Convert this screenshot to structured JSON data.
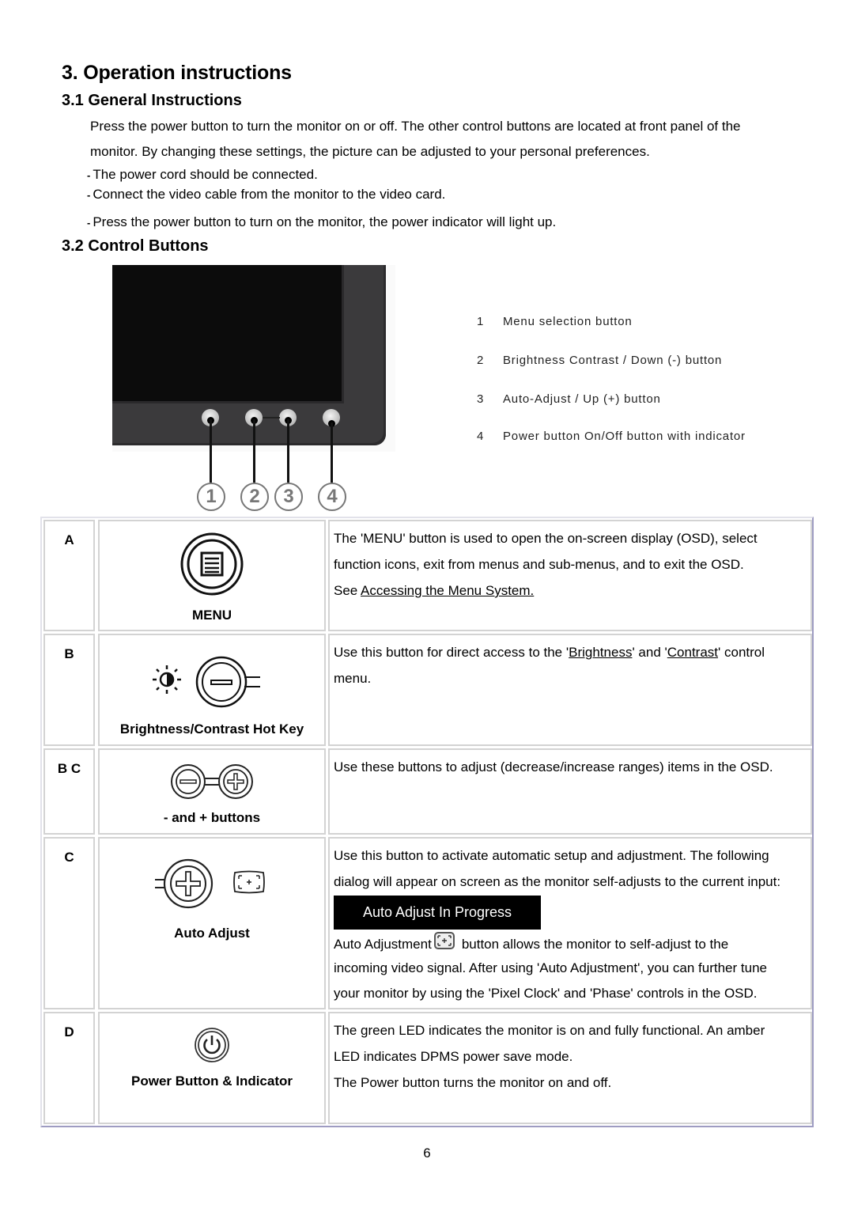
{
  "doc": {
    "title": "3. Operation instructions",
    "sections": {
      "general": {
        "heading": "3.1 General Instructions",
        "intro_line1": "Press the power button to turn the monitor on or off. The other control buttons are located at front panel of the",
        "intro_line2": "monitor. By changing these settings, the picture can be adjusted to your personal preferences.",
        "bullets": [
          "The power cord should be connected.",
          "Connect the video cable from the monitor to the video card.",
          "Press the power button to turn on the monitor, the power indicator will light up."
        ],
        "bullet_marker": "-"
      },
      "control": {
        "heading": "3.2 Control Buttons",
        "figure": {
          "callouts": [
            "1",
            "2",
            "3",
            "4"
          ],
          "legend": [
            {
              "num": "1",
              "label": "Menu selection button"
            },
            {
              "num": "2",
              "label": "Brightness Contrast / Down (-) button"
            },
            {
              "num": "3",
              "label": "Auto-Adjust / Up (+) button"
            },
            {
              "num": "4",
              "label": "Power button On/Off button with indicator"
            }
          ]
        }
      }
    },
    "table": {
      "rows": [
        {
          "letter": "A",
          "icon": "menu-button-icon",
          "caption": "MENU",
          "desc_line1": "The 'MENU' button is used to open the on-screen display (OSD), select",
          "desc_line2": "function icons, exit from menus and sub-menus, and to exit the OSD.",
          "desc_see": "See ",
          "desc_link": "Accessing the Menu System."
        },
        {
          "letter": "B",
          "icon": "brightness-contrast-hotkey-icon",
          "caption": "Brightness/Contrast Hot Key",
          "desc_pre": "Use this button for direct access to the '",
          "desc_link1": "Brightness",
          "desc_mid": "' and '",
          "desc_link2": "Contrast",
          "desc_post": "' control",
          "desc_line2": "menu."
        },
        {
          "letter": "B C",
          "icon": "minus-plus-buttons-icon",
          "caption": "- and + buttons",
          "desc": "Use these buttons to adjust (decrease/increase ranges) items in the OSD."
        },
        {
          "letter": "C",
          "icon": "auto-adjust-icon",
          "caption": "Auto Adjust",
          "desc_line1": "Use this button to activate automatic setup and adjustment. The following",
          "desc_line2": "dialog will appear on screen as the monitor self-adjusts to the current input:",
          "osd_message": "Auto Adjust In Progress",
          "desc_line3_pre": "Auto Adjustment",
          "desc_line3_post": "button allows the monitor to self-adjust to the",
          "desc_line4": "incoming video signal. After using 'Auto Adjustment', you can further tune",
          "desc_line5": "your monitor by using the 'Pixel Clock' and 'Phase' controls in the OSD."
        },
        {
          "letter": "D",
          "icon": "power-button-icon",
          "caption": "Power Button & Indicator",
          "desc_line1": "The green LED indicates the monitor is on and fully functional. An amber",
          "desc_line2": "LED indicates DPMS power save mode.",
          "desc_line3": "The Power button turns the monitor on and off."
        }
      ]
    },
    "page_number": "6"
  }
}
